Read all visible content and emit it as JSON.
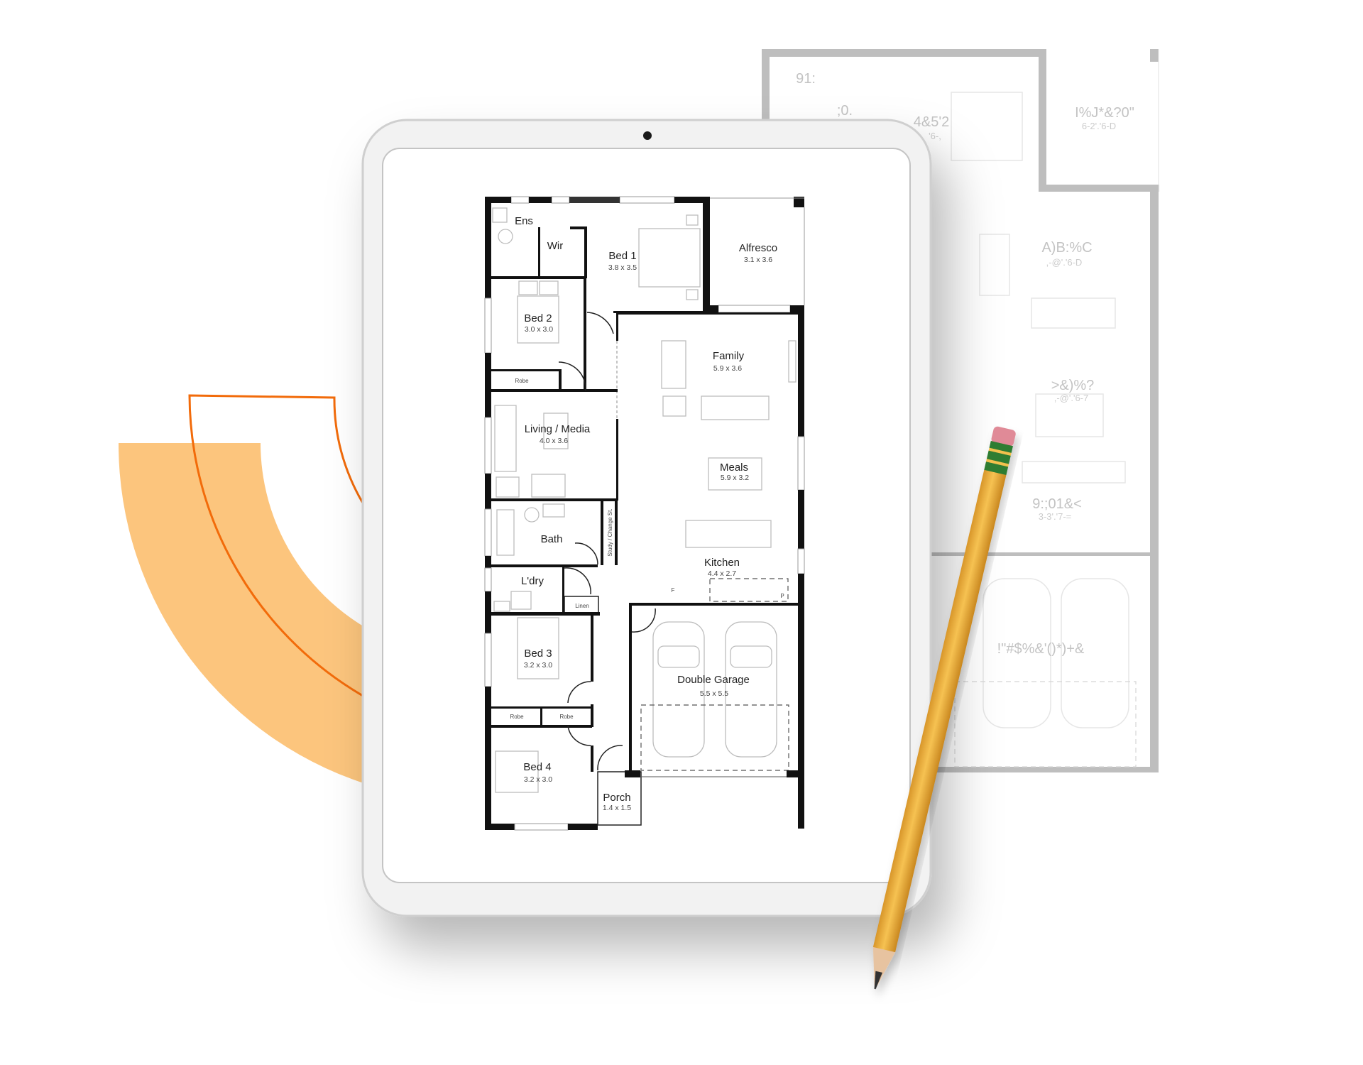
{
  "colors": {
    "accent_orange": "#f26b0a",
    "accent_orange_light": "#fcc57d",
    "tablet_frame": "#f2f2f2",
    "wall": "#111111",
    "pencil_body": "#f0b43c",
    "pencil_eraser": "#e08a97",
    "pencil_ferrule": "#2f7d32"
  },
  "floor_plan": {
    "rooms": {
      "ens": {
        "name": "Ens"
      },
      "wir": {
        "name": "Wir"
      },
      "bed1": {
        "name": "Bed 1",
        "dims": "3.8 x 3.5"
      },
      "alfresco": {
        "name": "Alfresco",
        "dims": "3.1 x 3.6"
      },
      "bed2": {
        "name": "Bed 2",
        "dims": "3.0 x 3.0"
      },
      "robe_bed2": {
        "name": "Robe"
      },
      "family": {
        "name": "Family",
        "dims": "5.9 x 3.6"
      },
      "living": {
        "name": "Living / Media",
        "dims": "4.0 x 3.6"
      },
      "meals": {
        "name": "Meals",
        "dims": "5.9 x 3.2"
      },
      "bath": {
        "name": "Bath"
      },
      "study": {
        "name": "Study / Change St."
      },
      "kitchen": {
        "name": "Kitchen",
        "dims": "4.4 x 2.7"
      },
      "fridge": {
        "name": "F"
      },
      "pantry": {
        "name": "P"
      },
      "laundry": {
        "name": "L'dry"
      },
      "linen": {
        "name": "Linen"
      },
      "bed3": {
        "name": "Bed 3",
        "dims": "3.2 x 3.0"
      },
      "robe_bed3": {
        "name": "Robe"
      },
      "robe_bed4": {
        "name": "Robe"
      },
      "garage": {
        "name": "Double Garage",
        "dims": "5.5 x 5.5"
      },
      "bed4": {
        "name": "Bed 4",
        "dims": "3.2 x 3.0"
      },
      "porch": {
        "name": "Porch",
        "dims": "1.4 x 1.5"
      }
    }
  },
  "background_plan": {
    "labels": [
      "91:",
      ";0.",
      "4&5'2",
      "'6-,",
      "I%J*&?0\"",
      "6-2'.'6-D",
      "A)B:%C",
      ",-@'.'6-D",
      ">&)%?",
      ",-@'.'6-7",
      "9:;01&<",
      "3-3'.'7-=",
      "!\"#$%&'()*)+&"
    ]
  }
}
